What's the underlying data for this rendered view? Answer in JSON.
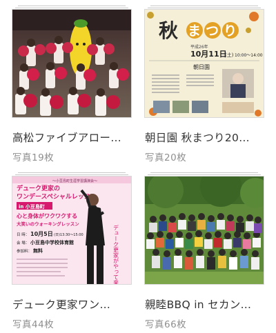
{
  "albums": [
    {
      "title": "高松ファイブアロー…",
      "count": "写真19枚",
      "thumb_alt": "cheerleaders photo"
    },
    {
      "title": "朝日園 秋まつり20…",
      "count": "写真20枚",
      "poster": {
        "heading_a": "秋",
        "heading_b": "まつり",
        "year": "平成26年",
        "date": "10月11日",
        "day": "(土)",
        "time": "10:00〜14:00",
        "venue": "朝日園"
      }
    },
    {
      "title": "デューク更家ワン…",
      "count": "写真44枚",
      "poster": {
        "banner": "〜小豆島町生涯学習講演会〜",
        "line1": "デューク更家の",
        "line2": "ワンデースペシャルレッスン",
        "place": "in 小豆島町",
        "copy1": "心と身体がワクワクする",
        "copy2": "大笑いのウォーキングレッスン",
        "date_label": "日 時：",
        "date": "10月5日",
        "date_time": "(日)13:30〜15:00",
        "venue_label": "会 場：",
        "venue": "小豆島中学校体育館",
        "fee_label": "参加料：",
        "fee": "無料",
        "vertical": "デューク更家がやって来る！"
      }
    },
    {
      "title": "親睦BBQ in セカン…",
      "count": "写真66枚",
      "thumb_alt": "group photo"
    }
  ],
  "colors": {
    "title": "#333333",
    "count": "#8f8f8f",
    "poster2_bg": "#f5efd8",
    "poster3_bg": "#fbe6f0",
    "poster3_accent": "#d6196d"
  }
}
